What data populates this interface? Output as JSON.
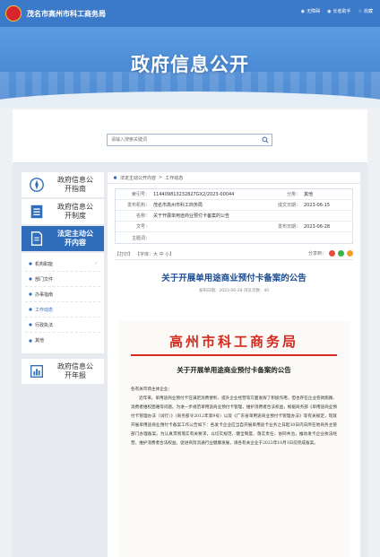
{
  "header": {
    "site_name": "茂名市高州市科工商务局",
    "links": [
      "无障碍",
      "长者助手",
      "收藏"
    ]
  },
  "banner": {
    "title": "政府信息公开"
  },
  "search": {
    "placeholder": "请输入搜索关键词"
  },
  "sidebar": {
    "cards": [
      {
        "label": "政府信息公开指南",
        "icon": "compass-icon"
      },
      {
        "label": "政府信息公开制度",
        "icon": "document-list-icon"
      },
      {
        "label": "法定主动公开内容",
        "icon": "document-icon",
        "active": true
      }
    ],
    "sub_items": [
      "机构职能",
      "部门文件",
      "办事指南",
      "工作动态",
      "行政执法",
      "其他"
    ],
    "bottom_card": {
      "label": "政府信息公开年报",
      "icon": "chart-report-icon"
    }
  },
  "breadcrumb": [
    "法定主动公开内容",
    "工作动态"
  ],
  "info": {
    "index_label": "索引号：",
    "index_value": "114409813232827GX2/2023-00044",
    "category_label": "分类：",
    "category_value": "其他",
    "issuer_label": "发布机构：",
    "issuer_value": "茂名市高州市科工商务局",
    "date_label": "成文日期：",
    "date_value": "2023-06-15",
    "name_label": "名称：",
    "name_value": "关于开展单用途商业预付卡备案的公告",
    "docno_label": "文号：",
    "docno_value": "",
    "pubdate_label": "发布日期：",
    "pubdate_value": "2023-06-28",
    "theme_label": "主题词：",
    "theme_value": ""
  },
  "toolbar": {
    "print": "【打印】",
    "font": "【字体：大 中 小】",
    "share": "分享到："
  },
  "article": {
    "title": "关于开展单用途商业预付卡备案的公告",
    "meta": "发布日期：2023-06-28  浏览次数：40"
  },
  "doc": {
    "org_head": "高州市科工商务局",
    "title": "关于开展单用途商业预付卡备案的公告",
    "salutation": "各有关市场主体企业：",
    "body": "近年来，单用途商业预付卡在满足消费便利、提升企业经营等方面发挥了积极作用，但也存在企业卷款跑路、消费者维权困难等问题。为进一步规范单用途商业预付卡管理，维护消费者合法权益，根据商务部《单用途商业预付卡管理办法（试行）》（商务部令2012年第9号）以及《广东省单用途商业预付卡管理办法》等有关规定，现就开展单用途商业预付卡备案工作公告如下：各发卡企业应当自开展单用途卡业务之日起30日内向所在地商务主管部门办理备案。为认真贯彻落实有关要求，以切实规范、健全制度、落实责任、协同共治，推动发卡企业依法经营，维护消费者合法权益，促进商贸流通行业健康发展，请各有关企业于2023年10月1日前完成备案。"
  }
}
